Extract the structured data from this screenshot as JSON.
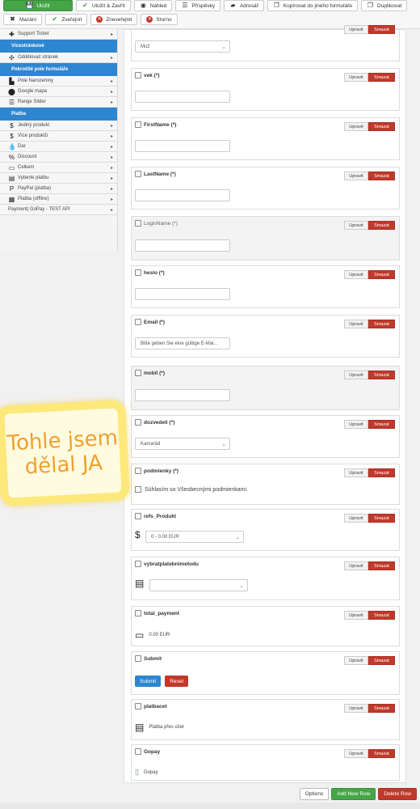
{
  "toolbar": {
    "row1": [
      {
        "label": "Uložit",
        "icon": "save-icon",
        "glyph": "💾"
      },
      {
        "label": "Uložit & Zavřít",
        "icon": "check-icon",
        "glyph": "✔"
      },
      {
        "label": "Náhled",
        "icon": "eye-icon",
        "glyph": "◉"
      },
      {
        "label": "Příspěvky",
        "icon": "list-icon",
        "glyph": "☰"
      },
      {
        "label": "Adresář",
        "icon": "folder-icon",
        "glyph": "▰"
      },
      {
        "label": "Kopírovat do jiného formuláře",
        "icon": "copy-icon",
        "glyph": "❐"
      },
      {
        "label": "Duplikovat",
        "icon": "duplicate-icon",
        "glyph": "❐"
      }
    ],
    "row2": [
      {
        "label": "Mazání",
        "icon": "close-icon",
        "glyph": "✖"
      },
      {
        "label": "Zveřejnit",
        "icon": "check-icon",
        "glyph": "✔"
      },
      {
        "label": "Zneveřejnit",
        "icon": "cancel-circle-icon",
        "glyph": "✕"
      },
      {
        "label": "Storno",
        "icon": "cancel-circle-icon",
        "glyph": "✕"
      }
    ]
  },
  "sidebar": {
    "items": [
      {
        "type": "item",
        "label": "Support Ticket",
        "icon": "support-icon",
        "glyph": "✚"
      },
      {
        "type": "head",
        "label": "Vícestránkové"
      },
      {
        "type": "item",
        "label": "Oddělovač stránek",
        "icon": "separator-icon",
        "glyph": "✣"
      },
      {
        "type": "head",
        "label": "Pokročilé pole formuláře"
      },
      {
        "type": "item",
        "label": "Pole Narozeniny",
        "icon": "birthday-icon",
        "glyph": "▙"
      },
      {
        "type": "item",
        "label": "Google mapa",
        "icon": "map-marker-icon",
        "glyph": "⬤"
      },
      {
        "type": "item",
        "label": "Range Slider",
        "icon": "slider-icon",
        "glyph": "☰"
      },
      {
        "type": "head",
        "label": "Platba"
      },
      {
        "type": "item",
        "label": "Jediný produkt",
        "icon": "dollar-icon",
        "glyph": "$"
      },
      {
        "type": "item",
        "label": "Více produktů",
        "icon": "dollar-icon",
        "glyph": "$"
      },
      {
        "type": "item",
        "label": "Dar",
        "icon": "drop-icon",
        "glyph": "💧"
      },
      {
        "type": "item",
        "label": "Discount",
        "icon": "percent-icon",
        "glyph": "%"
      },
      {
        "type": "item",
        "label": "Celkem",
        "icon": "money-icon",
        "glyph": "▭"
      },
      {
        "type": "item",
        "label": "Vyberte platbu",
        "icon": "card-icon",
        "glyph": "▤"
      },
      {
        "type": "item",
        "label": "PayPal (platba)",
        "icon": "paypal-icon",
        "glyph": "P"
      },
      {
        "type": "item",
        "label": "Platba (offline)",
        "icon": "offline-payment-icon",
        "glyph": "▦"
      },
      {
        "type": "item",
        "label": "Payment| GoPay - TEST API",
        "icon": "",
        "glyph": ""
      }
    ]
  },
  "buttons": {
    "edit": "Upravit",
    "delete": "Smazat"
  },
  "fields": {
    "muz": "Muž",
    "vek": "vek (*)",
    "firstname": "FirstName (*)",
    "lastname": "LastName (*)",
    "loginname": "LoginName (*)",
    "heslo": "heslo (*)",
    "email": "Email (*)",
    "email_placeholder": "Bitte geben Sie eine gültige E-Mai...",
    "mobil": "mobil (*)",
    "dozvedeli": "dozvedeli (*)",
    "dozvedeli_value": "Kamarád",
    "podminky": "podmienky (*)",
    "podminky_text": "Súhlasím so Všeobecnými podmienkami.",
    "refs_produkt": "refs_Produkt",
    "refs_value": "0 - 0.00 EUR",
    "vybrat": "vybratplatebnimetodu",
    "total_payment": "total_payment",
    "total_value": "0.00 EUR",
    "submit": "Submit",
    "submit_btn": "Submit",
    "reset_btn": "Reset",
    "platbacet": "platbacet",
    "platba_text": "Platba přes účet",
    "gopay": "Gopay",
    "gopay_text": "Gopay"
  },
  "bottom": {
    "options": "Options",
    "add": "Add New Row",
    "delete_row": "Delete Row"
  },
  "note": {
    "line1": "Tohle jsem",
    "line2": "dělal JA"
  },
  "colors": {
    "primary": "#2e86d1",
    "success": "#46a546",
    "danger": "#c0392b",
    "note_border": "#fde87a",
    "note_text": "#f0a030"
  }
}
